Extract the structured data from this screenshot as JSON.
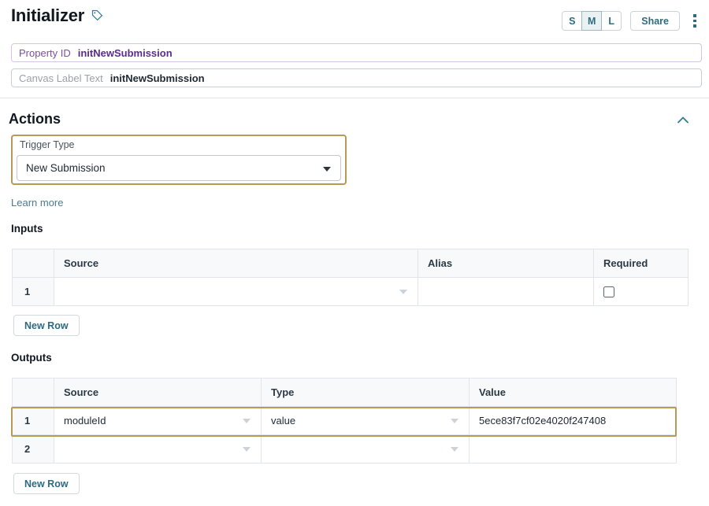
{
  "header": {
    "title": "Initializer",
    "tag_icon": "tag-icon",
    "size_options": [
      "S",
      "M",
      "L"
    ],
    "size_selected": "M",
    "share_label": "Share",
    "menu_icon": "kebab-menu-icon",
    "accent_color": "#2f6b80"
  },
  "fields": {
    "property_id": {
      "label": "Property ID",
      "value": "initNewSubmission",
      "border_color": "#d7c5e4",
      "label_color": "#7c4fa0",
      "value_color": "#5b2d8e"
    },
    "canvas_label_text": {
      "label": "Canvas Label Text",
      "value": "initNewSubmission",
      "border_color": "#c9ced4",
      "label_color": "#9aa2ab",
      "value_color": "#1f2933"
    }
  },
  "actions": {
    "title": "Actions",
    "collapse_icon": "chevron-up-icon",
    "trigger_type": {
      "label": "Trigger Type",
      "value": "New Submission",
      "caret_icon": "chevron-down-icon",
      "focus_border_color": "#b59b53"
    },
    "learn_more": "Learn more"
  },
  "inputs": {
    "label": "Inputs",
    "columns": [
      "",
      "Source",
      "Alias",
      "Required"
    ],
    "rows": [
      {
        "num": "1",
        "source": "",
        "alias": "",
        "required": false
      }
    ],
    "new_row_label": "New Row"
  },
  "outputs": {
    "label": "Outputs",
    "columns": [
      "",
      "Source",
      "Type",
      "Value"
    ],
    "rows": [
      {
        "num": "1",
        "source": "moduleId",
        "type": "value",
        "value": "5ece83f7cf02e4020f247408",
        "selected": true
      },
      {
        "num": "2",
        "source": "",
        "type": "",
        "value": "",
        "selected": false
      }
    ],
    "new_row_label": "New Row"
  }
}
